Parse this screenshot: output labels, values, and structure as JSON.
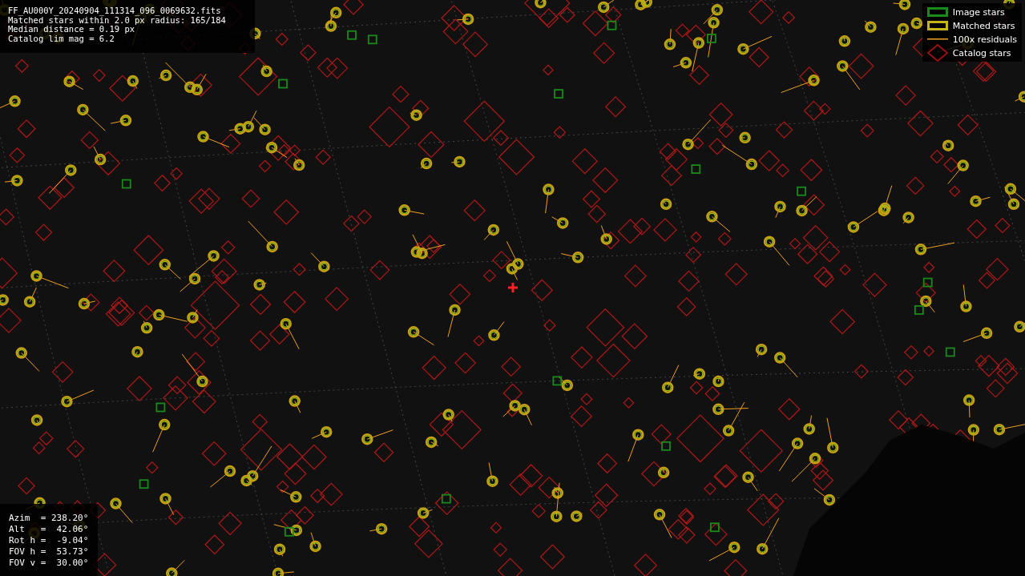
{
  "info": {
    "lines": [
      "FF_AU000Y_20240904_111314_096_0069632.fits",
      "Matched stars within 2.0 px radius: 165/184",
      "Median distance = 0.19 px",
      "Catalog lim mag = 6.2"
    ]
  },
  "legend": [
    {
      "kind": "image",
      "label": "Image stars"
    },
    {
      "kind": "matched",
      "label": "Matched stars"
    },
    {
      "kind": "residual",
      "label": "100x residuals"
    },
    {
      "kind": "catalog",
      "label": "Catalog stars"
    }
  ],
  "pointing": {
    "lines": [
      "Azim  = 238.20°",
      "Alt   =  42.06°",
      "Rot h =  -9.04°",
      "FOV h =  53.73°",
      "FOV v =  30.00°"
    ]
  }
}
